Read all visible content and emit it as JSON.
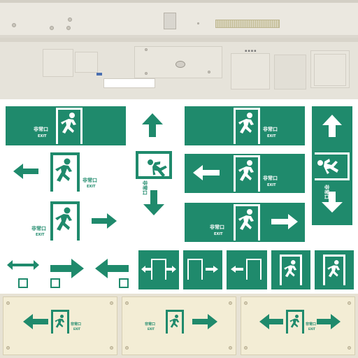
{
  "labels": {
    "ja": "非常口",
    "en": "EXIT"
  },
  "colors": {
    "sign_green": "#1f8a6c",
    "sign_white": "#ffffff",
    "panel_cream": "#f3edd5",
    "fixture_grey": "#e4e1d8"
  },
  "icons": [
    "running-person-icon",
    "door-icon",
    "arrow-left-icon",
    "arrow-right-icon",
    "arrow-up-icon",
    "arrow-down-icon",
    "double-arrow-icon"
  ]
}
